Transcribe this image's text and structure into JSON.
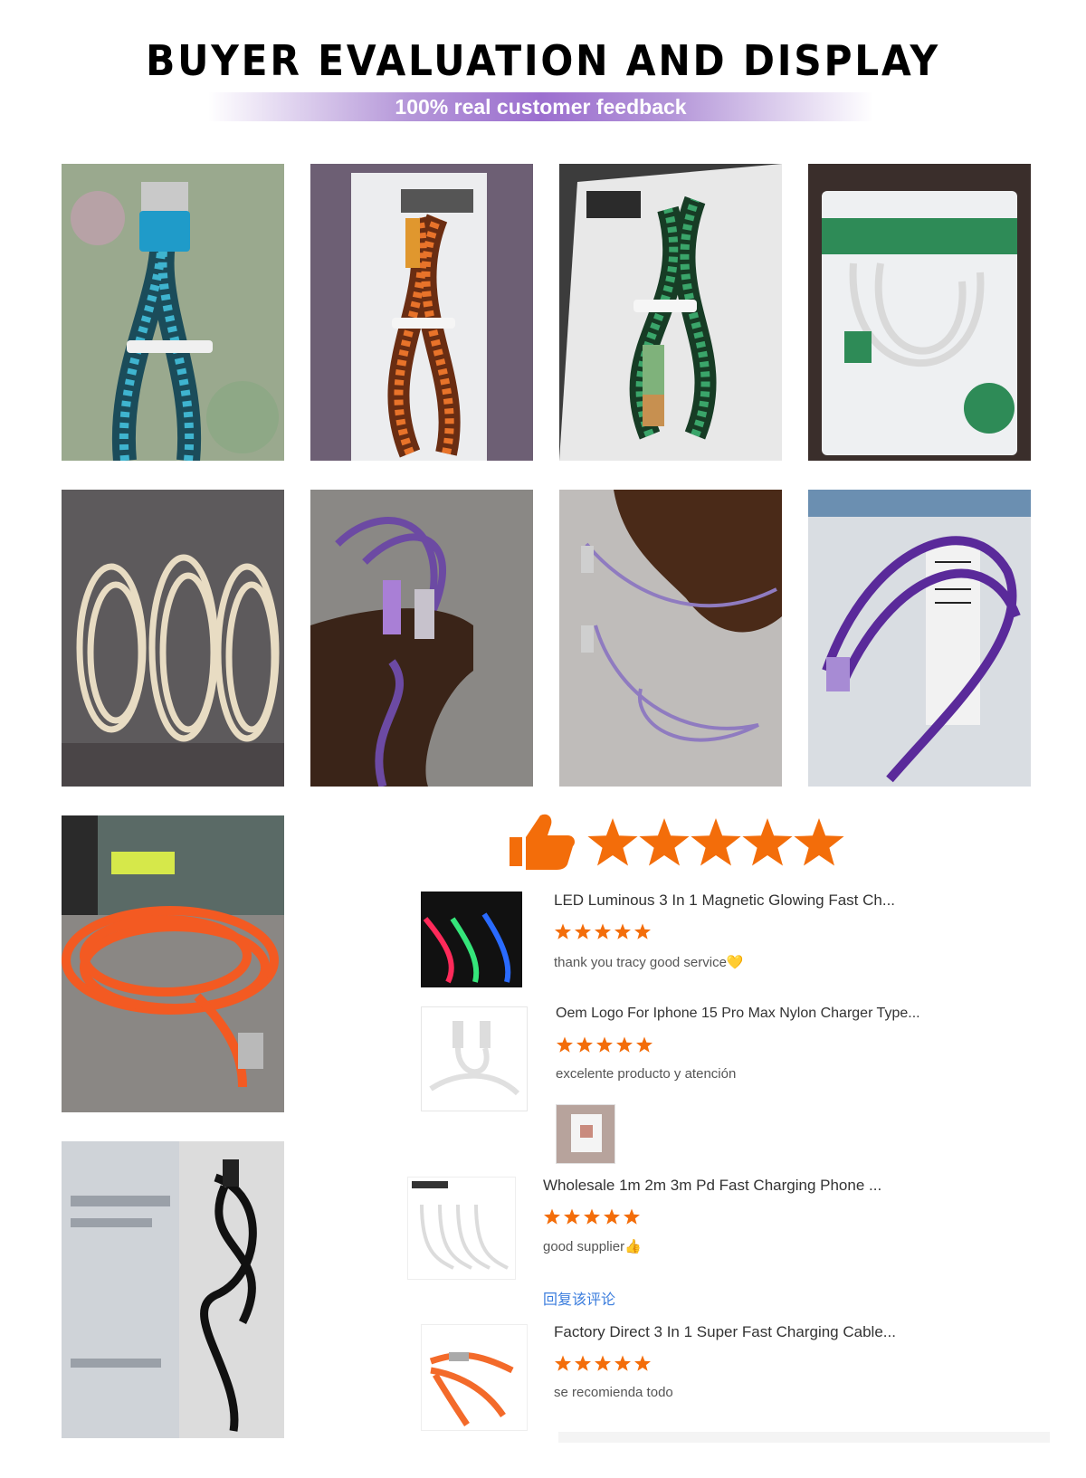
{
  "header": {
    "title": "BUYER EVALUATION AND DISPLAY",
    "subtitle": "100% real customer feedback"
  },
  "photos": [
    {
      "icon": "braided-blue-cable-photo"
    },
    {
      "icon": "braided-orange-cable-photo"
    },
    {
      "icon": "braided-green-cable-photo"
    },
    {
      "icon": "white-cable-package-photo"
    },
    {
      "icon": "beige-cables-photo"
    },
    {
      "icon": "purple-cable-hand-photo"
    },
    {
      "icon": "purple-cable-palm-photo"
    },
    {
      "icon": "purple-cable-package-photo"
    },
    {
      "icon": "orange-silicone-cable-photo"
    },
    {
      "icon": "black-cable-photo"
    }
  ],
  "rating": {
    "stars": 5,
    "icon": "thumbs-up-icon",
    "color": "#f36d0a"
  },
  "reviews": [
    {
      "title": "LED Luminous 3 In 1 Magnetic Glowing Fast Ch...",
      "stars": 5,
      "comment": "thank you tracy good service💛"
    },
    {
      "title": "Oem Logo For Iphone 15 Pro Max Nylon Charger Type...",
      "stars": 5,
      "comment": "excelente producto y atención"
    },
    {
      "title": "Wholesale 1m 2m 3m Pd Fast Charging Phone ...",
      "stars": 5,
      "comment": "good supplier👍",
      "reply": "回复该评论"
    },
    {
      "title": "Factory Direct 3 In 1 Super Fast Charging Cable...",
      "stars": 5,
      "comment": "se recomienda todo"
    }
  ]
}
